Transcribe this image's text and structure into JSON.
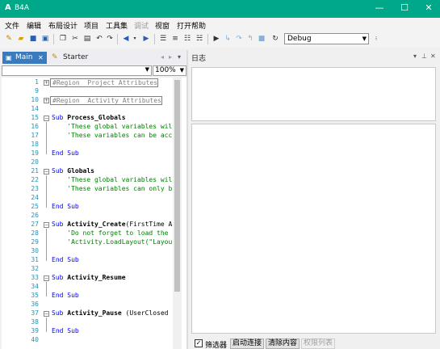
{
  "window": {
    "title": "B4A",
    "logo_glyph": "A",
    "minimize": "—",
    "maximize": "☐",
    "close": "✕"
  },
  "menu": [
    "文件",
    "编辑",
    "布局设计",
    "项目",
    "工具集",
    "调试",
    "视窗",
    "打开帮助"
  ],
  "toolbar": {
    "build_config": "Debug"
  },
  "tabs": {
    "main": "Main",
    "starter": "Starter"
  },
  "editor": {
    "zoom": "100%"
  },
  "code_lines": [
    {
      "n": "1",
      "region": "#Region  Project Attributes"
    },
    {
      "n": "9"
    },
    {
      "n": "10",
      "region": "#Region  Activity Attributes"
    },
    {
      "n": "14"
    },
    {
      "n": "15",
      "kw": "Sub ",
      "name": "Process_Globals",
      "fold": "-"
    },
    {
      "n": "16",
      "comment": "    'These global variables wil"
    },
    {
      "n": "17",
      "comment": "    'These variables can be acc"
    },
    {
      "n": "18"
    },
    {
      "n": "19",
      "kw": "End Sub"
    },
    {
      "n": "20"
    },
    {
      "n": "21",
      "kw": "Sub ",
      "name": "Globals",
      "fold": "-"
    },
    {
      "n": "22",
      "comment": "    'These global variables wil"
    },
    {
      "n": "23",
      "comment": "    'These variables can only b"
    },
    {
      "n": "24"
    },
    {
      "n": "25",
      "kw": "End Sub"
    },
    {
      "n": "26"
    },
    {
      "n": "27",
      "kw": "Sub ",
      "name": "Activity_Create",
      "rest": "(FirstTime A",
      "fold": "-"
    },
    {
      "n": "28",
      "comment": "    'Do not forget to load the"
    },
    {
      "n": "29",
      "comment": "    'Activity.LoadLayout(\"Layou"
    },
    {
      "n": "30"
    },
    {
      "n": "31",
      "kw": "End Sub"
    },
    {
      "n": "32"
    },
    {
      "n": "33",
      "kw": "Sub ",
      "name": "Activity_Resume",
      "fold": "-"
    },
    {
      "n": "34"
    },
    {
      "n": "35",
      "kw": "End Sub"
    },
    {
      "n": "36"
    },
    {
      "n": "37",
      "kw": "Sub ",
      "name": "Activity_Pause",
      "rest": " (UserClosed ",
      "fold": "-"
    },
    {
      "n": "38"
    },
    {
      "n": "39",
      "kw": "End Sub"
    },
    {
      "n": "40"
    }
  ],
  "log": {
    "title": "日志",
    "filter_label": "筛选器",
    "filter_checked": "✓",
    "connect": "启动连接",
    "clear": "清除内容",
    "permissions": "权限列表"
  }
}
